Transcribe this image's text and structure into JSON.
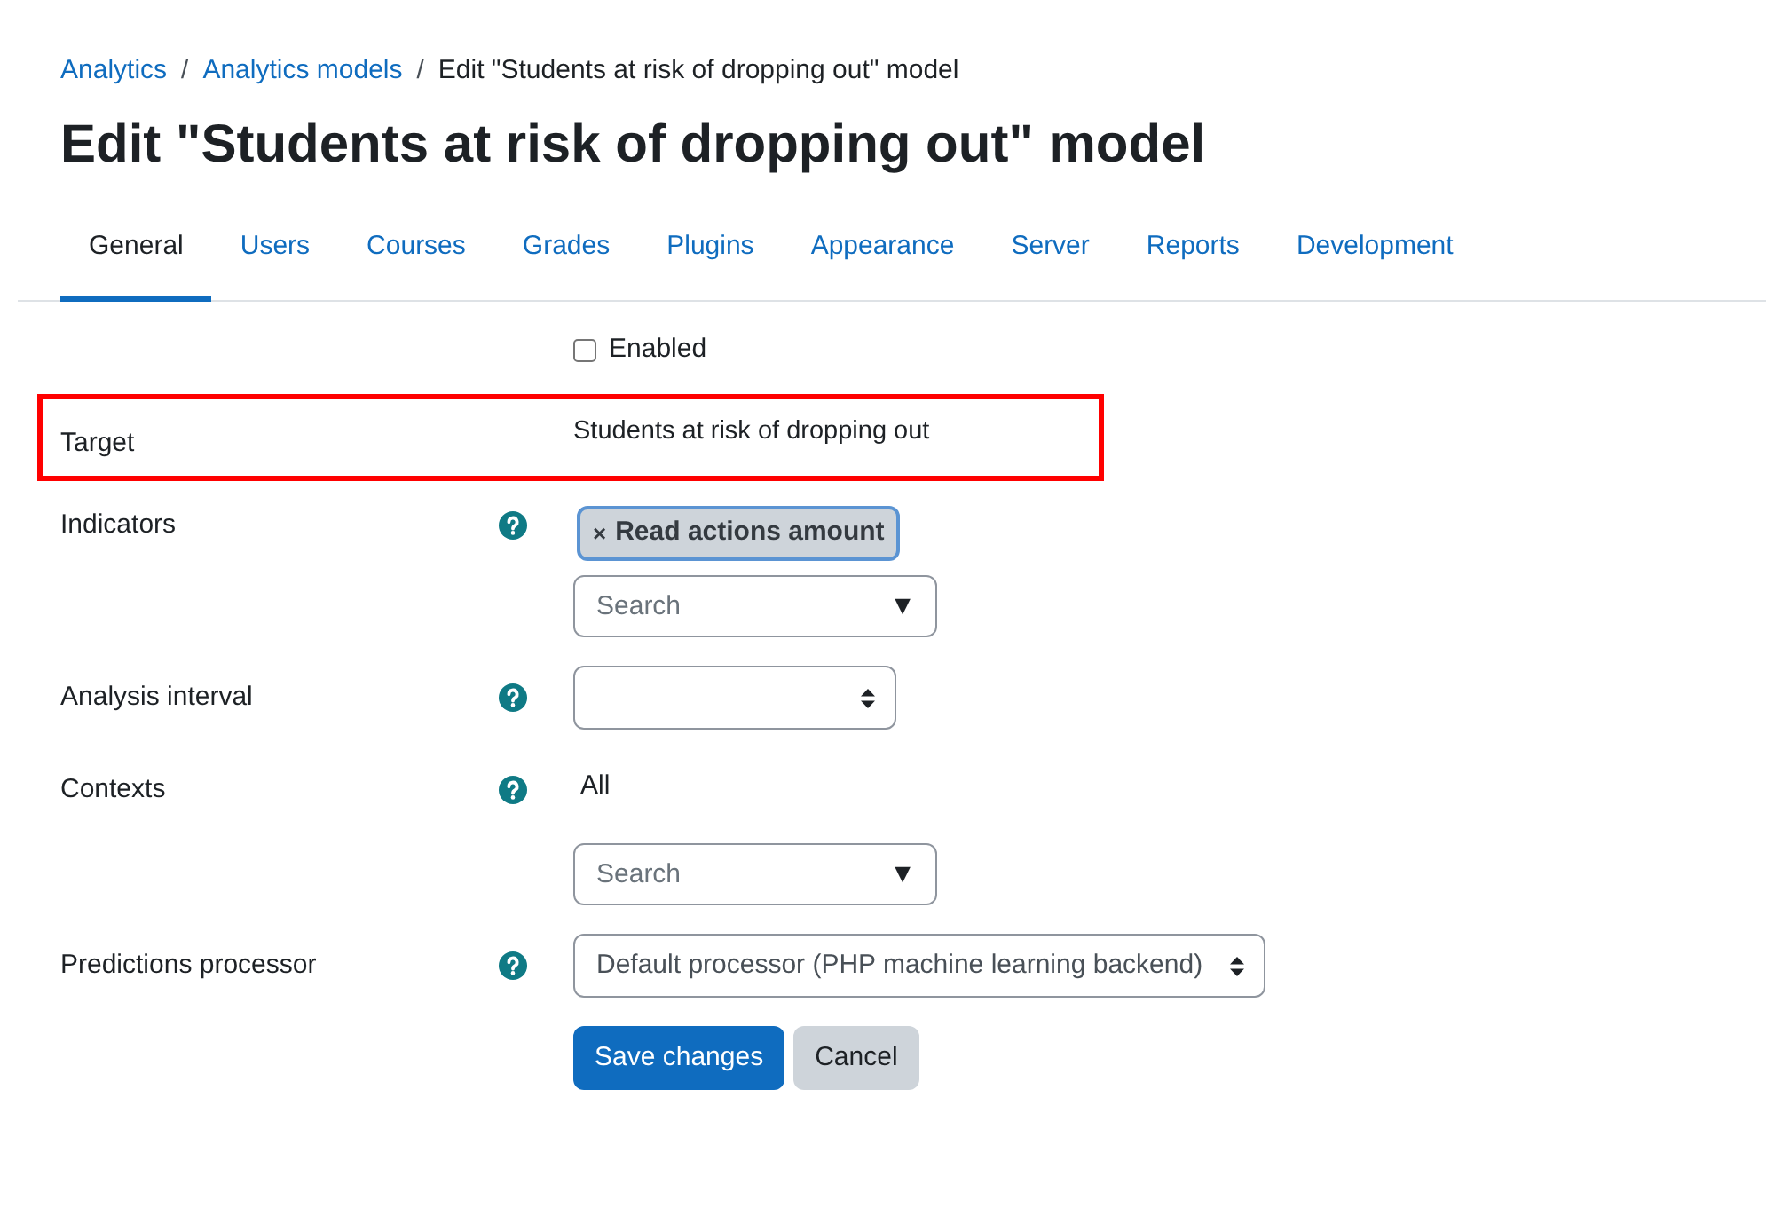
{
  "breadcrumb": [
    {
      "label": "Analytics",
      "link": true
    },
    {
      "separator": "/",
      "label": "Analytics models",
      "link": true
    },
    {
      "separator": "/",
      "label": "Edit \"Students at risk of dropping out\" model",
      "link": false
    }
  ],
  "title": "Edit \"Students at risk of dropping out\" model",
  "tabs": [
    {
      "label": "General",
      "selected": true
    },
    {
      "label": "Users",
      "selected": false
    },
    {
      "label": "Courses",
      "selected": false
    },
    {
      "label": "Grades",
      "selected": false
    },
    {
      "label": "Plugins",
      "selected": false
    },
    {
      "label": "Appearance",
      "selected": false
    },
    {
      "label": "Server",
      "selected": false
    },
    {
      "label": "Reports",
      "selected": false
    },
    {
      "label": "Development",
      "selected": false
    }
  ],
  "form": {
    "fields": [
      {
        "kind": "checkbox",
        "label": "Enabled",
        "checked": false,
        "help": false,
        "highlighted": false
      },
      {
        "kind": "static",
        "label": "Target",
        "value": "Students at risk of dropping out",
        "help": false,
        "highlighted": true
      },
      {
        "kind": "autocomplete",
        "label": "Indicators",
        "help": true,
        "highlighted": false,
        "chips": [
          {
            "remove": "×",
            "label": "Read actions amount",
            "focused": true
          }
        ],
        "placeholder": "Search",
        "arrow": "▼"
      },
      {
        "kind": "select",
        "label": "Analysis interval",
        "help": true,
        "highlighted": false
      },
      {
        "kind": "autocomplete",
        "label": "Contexts",
        "help": true,
        "highlighted": false,
        "selection_text": "All",
        "placeholder": "Search",
        "arrow": "▼"
      },
      {
        "kind": "select",
        "label": "Predictions processor",
        "help": true,
        "highlighted": false,
        "value": "Default processor (PHP machine learning backend)"
      }
    ],
    "buttons": [
      {
        "label": "Save changes",
        "kind": "primary"
      },
      {
        "label": "Cancel",
        "kind": "secondary"
      }
    ]
  }
}
